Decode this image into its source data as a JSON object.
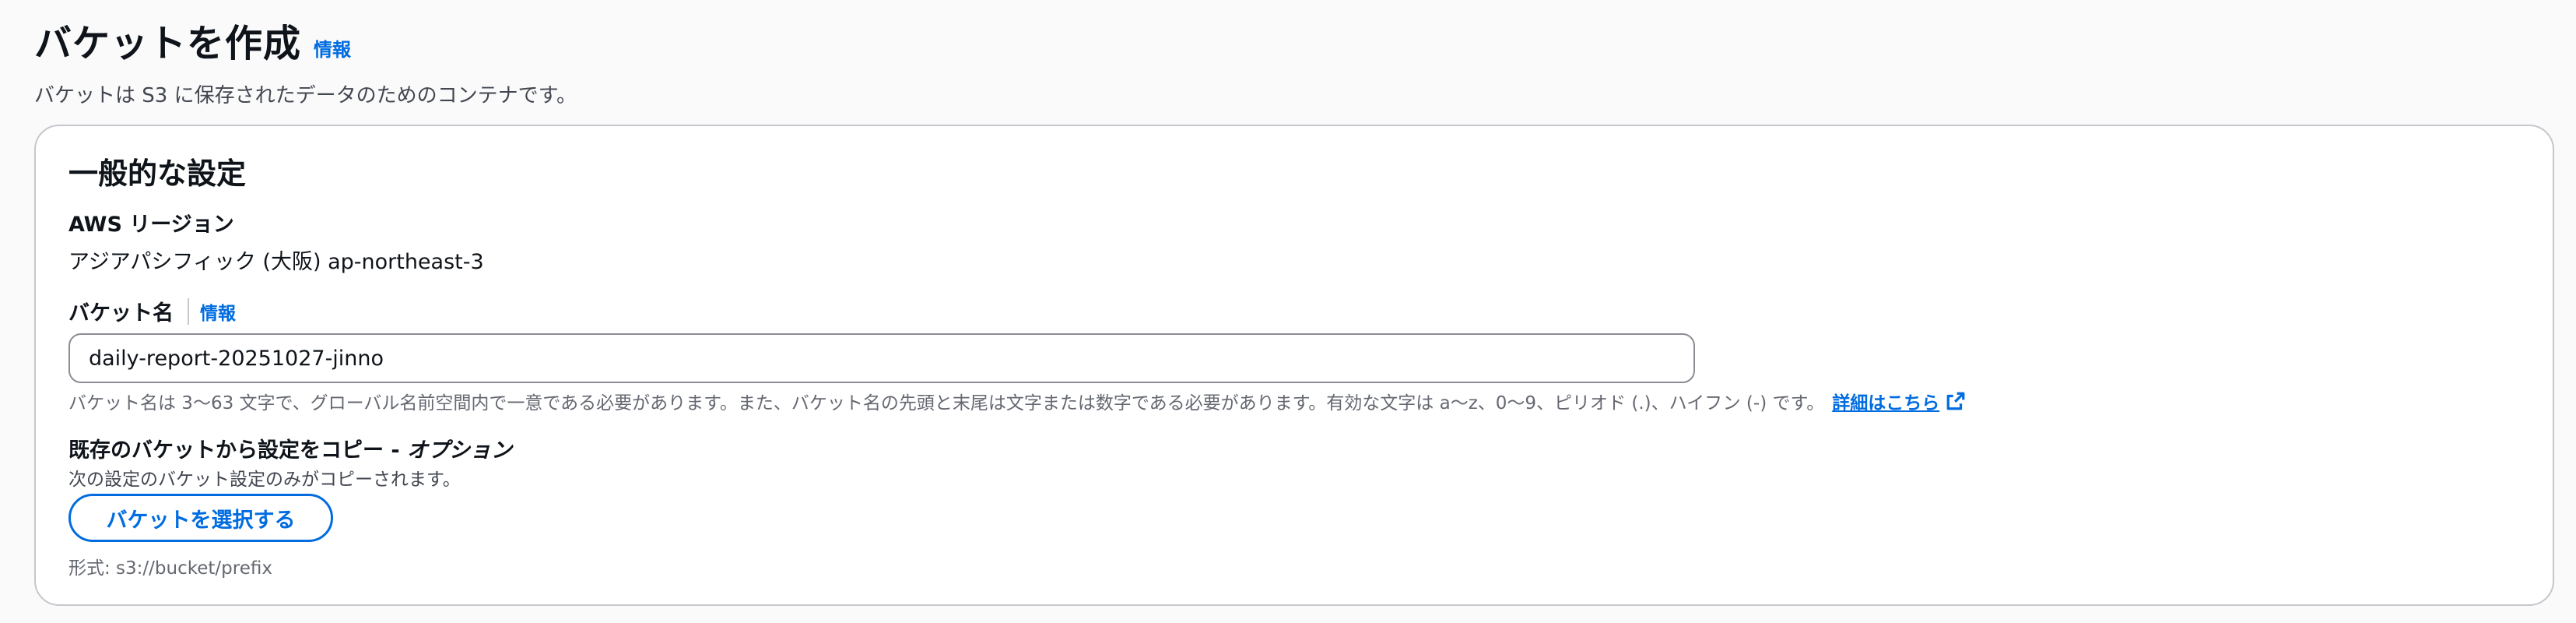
{
  "header": {
    "title": "バケットを作成",
    "info_label": "情報",
    "description": "バケットは S3 に保存されたデータのためのコンテナです。"
  },
  "general": {
    "section_title": "一般的な設定",
    "region_label": "AWS リージョン",
    "region_value": "アジアパシフィック (大阪) ap-northeast-3",
    "bucket_name_label": "バケット名",
    "bucket_name_info": "情報",
    "bucket_name_value": "daily-report-20251027-jinno",
    "bucket_name_hint": "バケット名は 3〜63 文字で、グローバル名前空間内で一意である必要があります。また、バケット名の先頭と末尾は文字または数字である必要があります。有効な文字は a〜z、0〜9、ピリオド (.)、ハイフン (-) です。",
    "learn_more_link": "詳細はこちら",
    "copy_label": "既存のバケットから設定をコピー - ",
    "copy_label_optional": "オプション",
    "copy_description": "次の設定のバケット設定のみがコピーされます。",
    "choose_bucket_button": "バケットを選択する",
    "format_hint": "形式: s3://bucket/prefix"
  },
  "icons": {
    "external_link": "external-link-icon"
  },
  "colors": {
    "link": "#006ce0",
    "border": "#c6c6cd",
    "input_border": "#8c8c94",
    "secondary_text": "#656871"
  }
}
